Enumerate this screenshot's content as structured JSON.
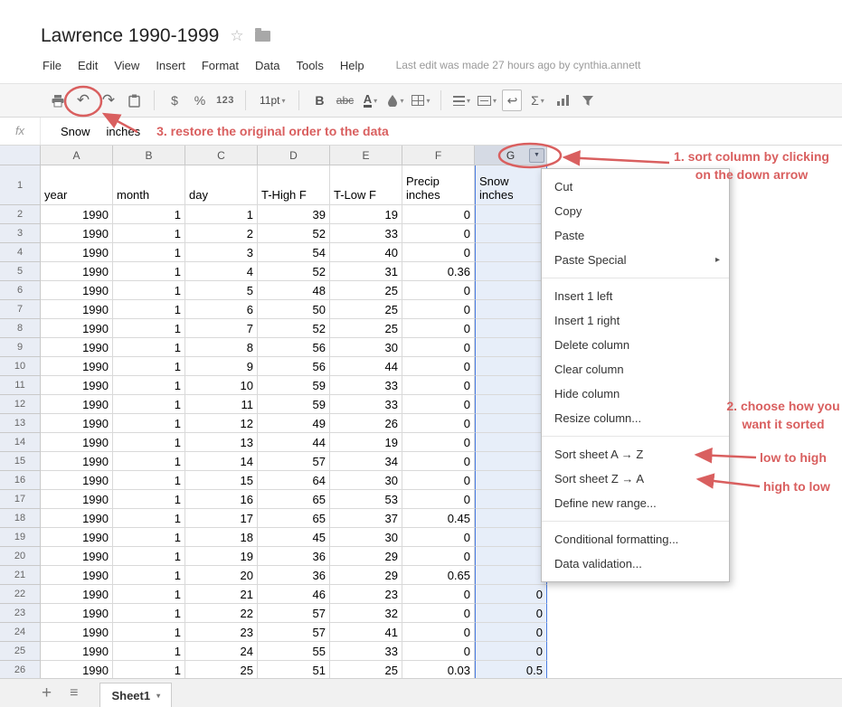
{
  "colors": {
    "annotation_red": "#d95f5f",
    "selection_border": "#4a7de2",
    "selection_fill": "#e7eef9"
  },
  "icons": {
    "star": "☆",
    "caret_down": "▾",
    "dropdown_arrow": "▼",
    "submenu_arrow": "▸",
    "plus": "+",
    "hamburger": "≡"
  },
  "header": {
    "title": "Lawrence 1990-1999",
    "menu_items": [
      "File",
      "Edit",
      "View",
      "Insert",
      "Format",
      "Data",
      "Tools",
      "Help"
    ],
    "last_edit": "Last edit was made 27 hours ago by cynthia.annett"
  },
  "toolbar": {
    "undo_glyph": "↶",
    "redo_glyph": "↷",
    "currency": "$",
    "percent": "%",
    "number_format": "123",
    "font_size": "11pt",
    "bold": "B",
    "strikethrough": "abc",
    "text_color": "A",
    "wrap_glyph": "↩",
    "sum": "Σ"
  },
  "formula_bar": {
    "fx_label": "fx",
    "value_word1": "Snow",
    "value_word2": "inches"
  },
  "annotations": {
    "step1": "1. sort column by clicking\non the down arrow",
    "step2": "2. choose how you\nwant it sorted",
    "step3": "3. restore the original order to the data",
    "low_to_high": "low to high",
    "high_to_low": "high to low"
  },
  "context_menu": {
    "groups": [
      [
        {
          "label": "Cut"
        },
        {
          "label": "Copy"
        },
        {
          "label": "Paste"
        },
        {
          "label": "Paste Special",
          "submenu": true
        }
      ],
      [
        {
          "label": "Insert 1 left"
        },
        {
          "label": "Insert 1 right"
        },
        {
          "label": "Delete column"
        },
        {
          "label": "Clear column"
        },
        {
          "label": "Hide column"
        },
        {
          "label": "Resize column..."
        }
      ],
      [
        {
          "label": "Sort sheet A → Z"
        },
        {
          "label": "Sort sheet Z → A"
        },
        {
          "label": "Define new range..."
        }
      ],
      [
        {
          "label": "Conditional formatting..."
        },
        {
          "label": "Data validation..."
        }
      ]
    ]
  },
  "sheet": {
    "columns": [
      "A",
      "B",
      "C",
      "D",
      "E",
      "F",
      "G"
    ],
    "selected_column": "G",
    "header_row": [
      "year",
      "month",
      "day",
      "T-High F",
      "T-Low F",
      "Precip inches",
      "Snow inches"
    ],
    "rows": [
      [
        "1990",
        "1",
        "1",
        "39",
        "19",
        "0",
        ""
      ],
      [
        "1990",
        "1",
        "2",
        "52",
        "33",
        "0",
        ""
      ],
      [
        "1990",
        "1",
        "3",
        "54",
        "40",
        "0",
        ""
      ],
      [
        "1990",
        "1",
        "4",
        "52",
        "31",
        "0.36",
        ""
      ],
      [
        "1990",
        "1",
        "5",
        "48",
        "25",
        "0",
        ""
      ],
      [
        "1990",
        "1",
        "6",
        "50",
        "25",
        "0",
        ""
      ],
      [
        "1990",
        "1",
        "7",
        "52",
        "25",
        "0",
        ""
      ],
      [
        "1990",
        "1",
        "8",
        "56",
        "30",
        "0",
        ""
      ],
      [
        "1990",
        "1",
        "9",
        "56",
        "44",
        "0",
        ""
      ],
      [
        "1990",
        "1",
        "10",
        "59",
        "33",
        "0",
        ""
      ],
      [
        "1990",
        "1",
        "11",
        "59",
        "33",
        "0",
        ""
      ],
      [
        "1990",
        "1",
        "12",
        "49",
        "26",
        "0",
        ""
      ],
      [
        "1990",
        "1",
        "13",
        "44",
        "19",
        "0",
        ""
      ],
      [
        "1990",
        "1",
        "14",
        "57",
        "34",
        "0",
        ""
      ],
      [
        "1990",
        "1",
        "15",
        "64",
        "30",
        "0",
        ""
      ],
      [
        "1990",
        "1",
        "16",
        "65",
        "53",
        "0",
        ""
      ],
      [
        "1990",
        "1",
        "17",
        "65",
        "37",
        "0.45",
        ""
      ],
      [
        "1990",
        "1",
        "18",
        "45",
        "30",
        "0",
        ""
      ],
      [
        "1990",
        "1",
        "19",
        "36",
        "29",
        "0",
        ""
      ],
      [
        "1990",
        "1",
        "20",
        "36",
        "29",
        "0.65",
        ""
      ],
      [
        "1990",
        "1",
        "21",
        "46",
        "23",
        "0",
        "0"
      ],
      [
        "1990",
        "1",
        "22",
        "57",
        "32",
        "0",
        "0"
      ],
      [
        "1990",
        "1",
        "23",
        "57",
        "41",
        "0",
        "0"
      ],
      [
        "1990",
        "1",
        "24",
        "55",
        "33",
        "0",
        "0"
      ],
      [
        "1990",
        "1",
        "25",
        "51",
        "25",
        "0.03",
        "0.5"
      ]
    ]
  },
  "footer": {
    "sheet_name": "Sheet1"
  }
}
